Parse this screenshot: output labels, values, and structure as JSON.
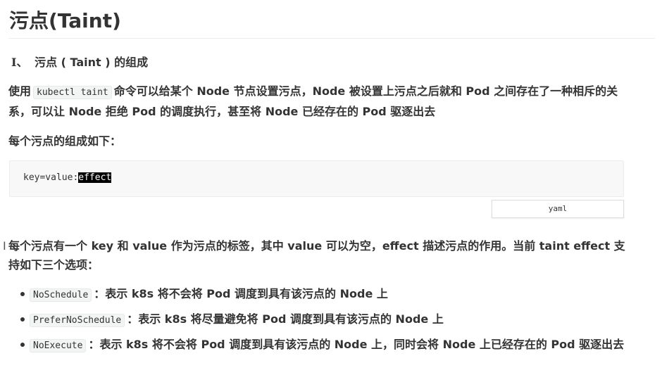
{
  "page": {
    "title": "污点(Taint)"
  },
  "section": {
    "number": "I、",
    "heading": "污点 ( Taint ) 的组成"
  },
  "intro": {
    "before": "使用",
    "code": "kubectl taint",
    "after": "命令可以给某个 Node 节点设置污点，Node 被设置上污点之后就和 Pod 之间存在了一种相斥的关系，可以让 Node 拒绝 Pod 的调度执行，甚至将 Node 已经存在的 Pod 驱逐出去"
  },
  "composition_heading": "每个污点的组成如下：",
  "code_block": {
    "prefix": "key=value:",
    "selected": "effect",
    "language": "yaml"
  },
  "description": "每个污点有一个 key 和 value 作为污点的标签，其中 value 可以为空，effect 描述污点的作用。当前 taint effect 支持如下三个选项：",
  "effects": [
    {
      "code": "NoSchedule",
      "desc": "：表示 k8s 将不会将 Pod 调度到具有该污点的 Node 上"
    },
    {
      "code": "PreferNoSchedule",
      "desc": "：表示 k8s 将尽量避免将 Pod 调度到具有该污点的 Node 上"
    },
    {
      "code": "NoExecute",
      "desc": "：表示 k8s 将不会将 Pod 调度到具有该污点的 Node 上，同时会将 Node 上已经存在的 Pod 驱逐出去"
    }
  ]
}
